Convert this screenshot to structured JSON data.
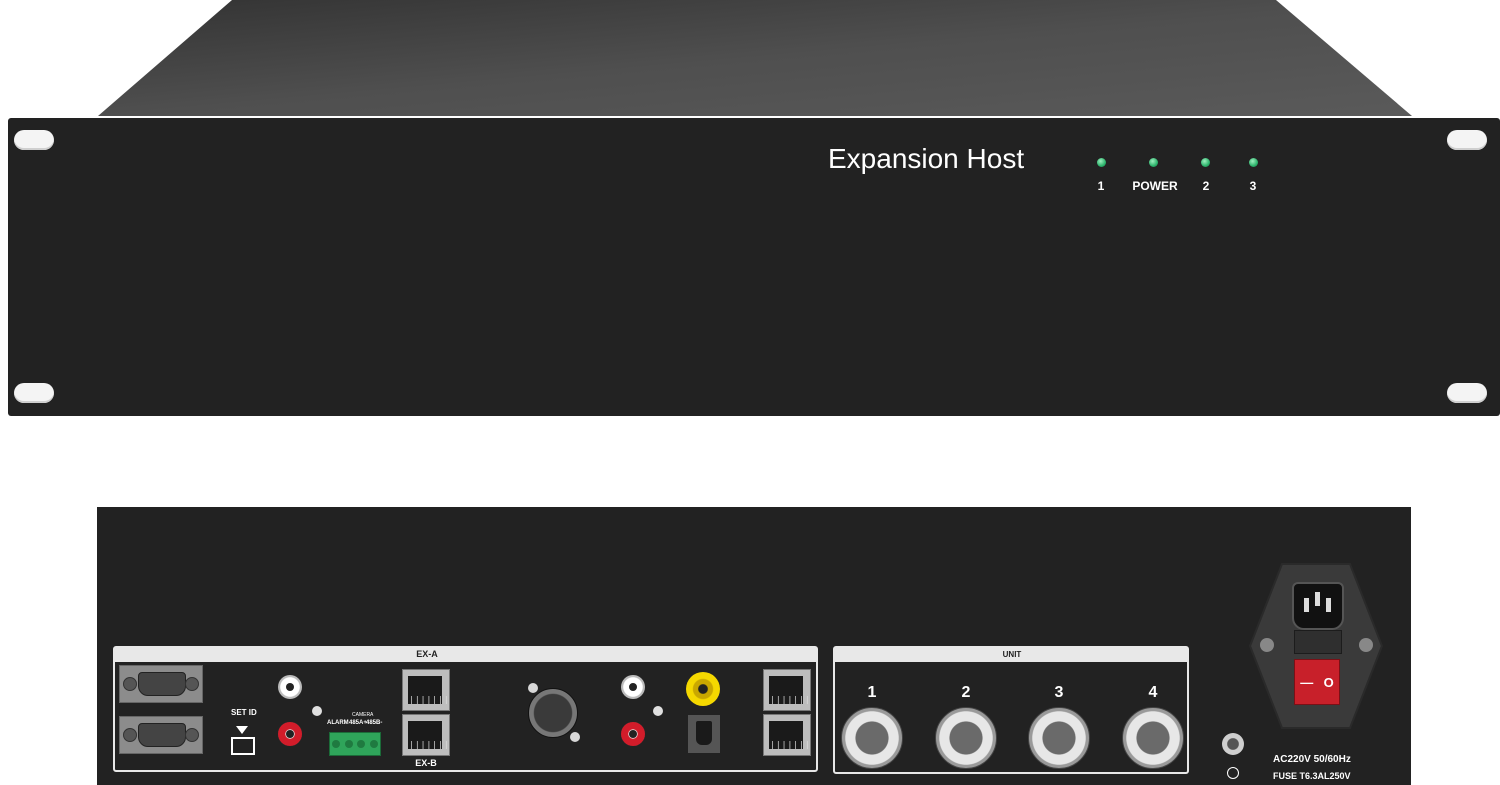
{
  "front_panel": {
    "title": "Expansion Host",
    "indicators": [
      {
        "label": "1"
      },
      {
        "label": "POWER"
      },
      {
        "label": "2"
      },
      {
        "label": "3"
      }
    ]
  },
  "rear_panel": {
    "set_id_label": "SET ID",
    "ex_a_label": "EX-A",
    "ex_b_label": "EX-B",
    "terminal_labels": {
      "alarm": "ALARM",
      "camera": "CAMERA",
      "rs485a": "485A+",
      "rs485b": "485B-"
    },
    "unit_label": "UNIT",
    "units": [
      {
        "label": "1"
      },
      {
        "label": "2"
      },
      {
        "label": "3"
      },
      {
        "label": "4"
      }
    ],
    "power_rating": "AC220V 50/60Hz",
    "fuse_rating": "FUSE T6.3AL250V",
    "switch_on": "—",
    "switch_off": "O"
  },
  "colors": {
    "chassis": "#222222",
    "lid_dark": "#3a3a3a",
    "lid_light": "#555555",
    "led_green": "#2bb36b",
    "switch_red": "#c8202a"
  }
}
